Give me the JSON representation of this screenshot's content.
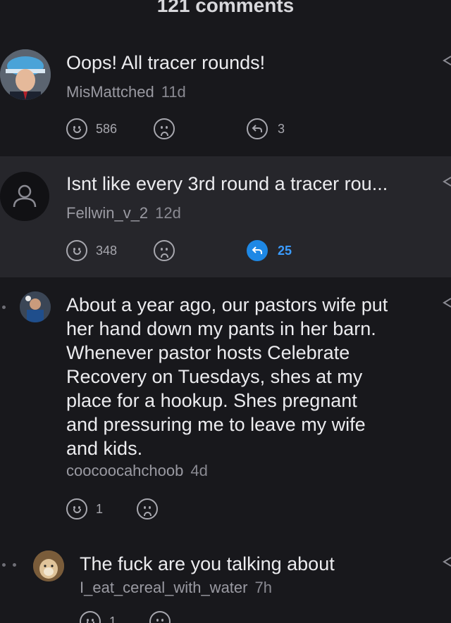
{
  "header": {
    "title": "121 comments"
  },
  "comments": [
    {
      "text": "Oops! All tracer rounds!",
      "author": "MisMattched",
      "age": "11d",
      "upvotes": "586",
      "replies": "3"
    },
    {
      "text": "Isnt like every 3rd round a tracer rou...",
      "author": "Fellwin_v_2",
      "age": "12d",
      "upvotes": "348",
      "replies": "25"
    },
    {
      "text_lines": [
        "About a year ago, our pastors wife put",
        "her hand down my pants in her barn.",
        "Whenever pastor hosts Celebrate",
        "Recovery on Tuesdays, shes at my",
        "place for a hookup. Shes pregnant",
        "and pressuring me to leave my wife",
        "and kids."
      ],
      "author": "coocoocahchoob",
      "age": "4d",
      "upvotes": "1"
    },
    {
      "text": "The fuck are you talking about",
      "author": "I_eat_cereal_with_water",
      "age": "7h",
      "upvotes": "1"
    }
  ],
  "colors": {
    "accent": "#1e88e5",
    "background": "#18181c",
    "highlight": "#26262b"
  }
}
